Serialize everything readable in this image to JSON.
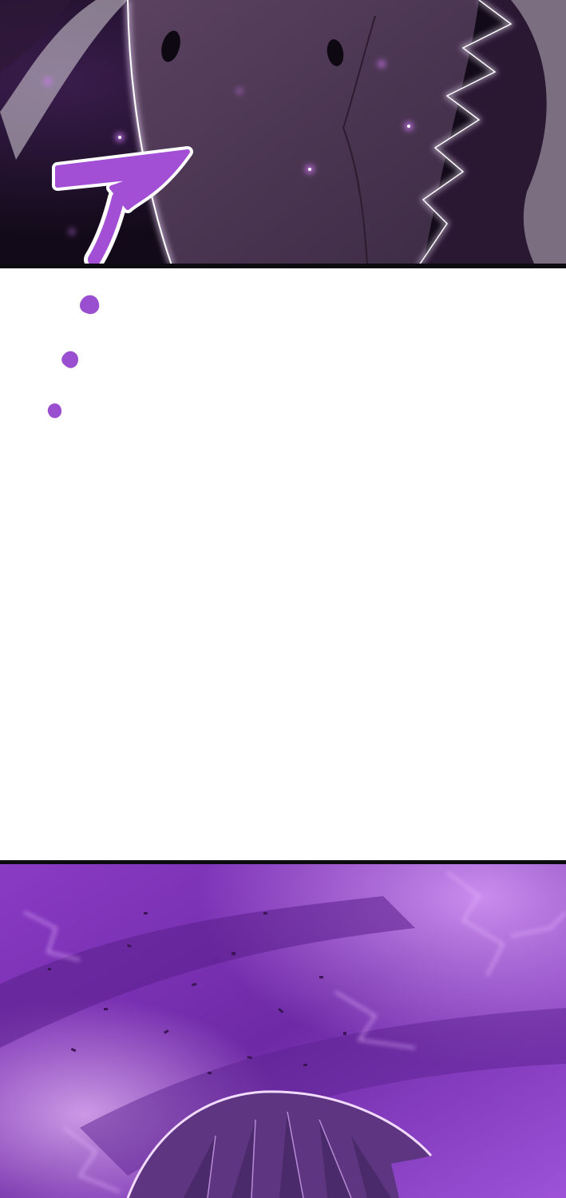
{
  "page": {
    "kind": "webtoon-strip",
    "panels": [
      {
        "id": "top",
        "description_tag": "creature-closeup"
      },
      {
        "id": "gutter"
      },
      {
        "id": "bottom",
        "description_tag": "character-in-purple-aura"
      }
    ]
  },
  "sfx": {
    "glyph": "ア",
    "color": "#a24fd6",
    "outline": "#ffffff"
  },
  "colors": {
    "border": "#0c0c10",
    "aura_purple": "#9b4fd9",
    "dark_purple": "#2a1736",
    "glow": "#c87bff"
  },
  "icons": {
    "dots": "ellipsis-drops-icon"
  }
}
